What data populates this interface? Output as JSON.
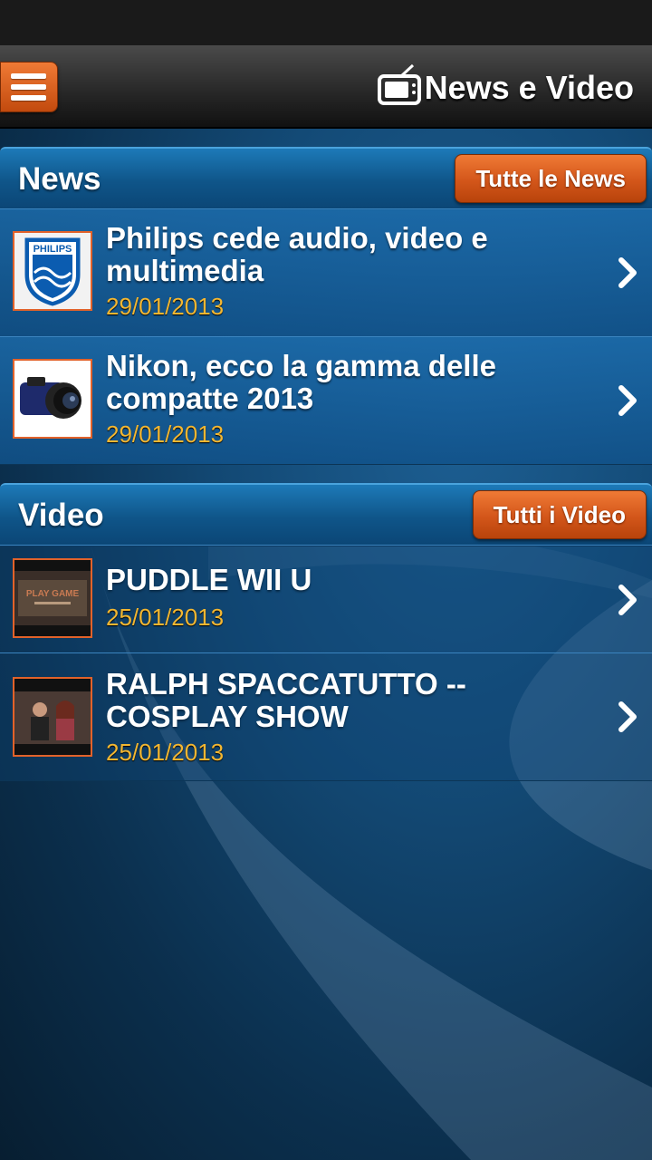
{
  "app": {
    "title": "News e Video"
  },
  "news": {
    "title": "News",
    "all_button": "Tutte le News",
    "items": [
      {
        "title": "Philips cede audio, video e multimedia",
        "date": "29/01/2013"
      },
      {
        "title": "Nikon, ecco la gamma delle compatte 2013",
        "date": "29/01/2013"
      }
    ]
  },
  "video": {
    "title": "Video",
    "all_button": "Tutti i Video",
    "items": [
      {
        "title": "PUDDLE WII U",
        "date": "25/01/2013"
      },
      {
        "title": "RALPH SPACCATUTTO -- COSPLAY SHOW",
        "date": "25/01/2013"
      }
    ]
  },
  "thumbnails": {
    "philips_logo_text": "PHILIPS",
    "puddle_text": "PLAY GAME"
  }
}
